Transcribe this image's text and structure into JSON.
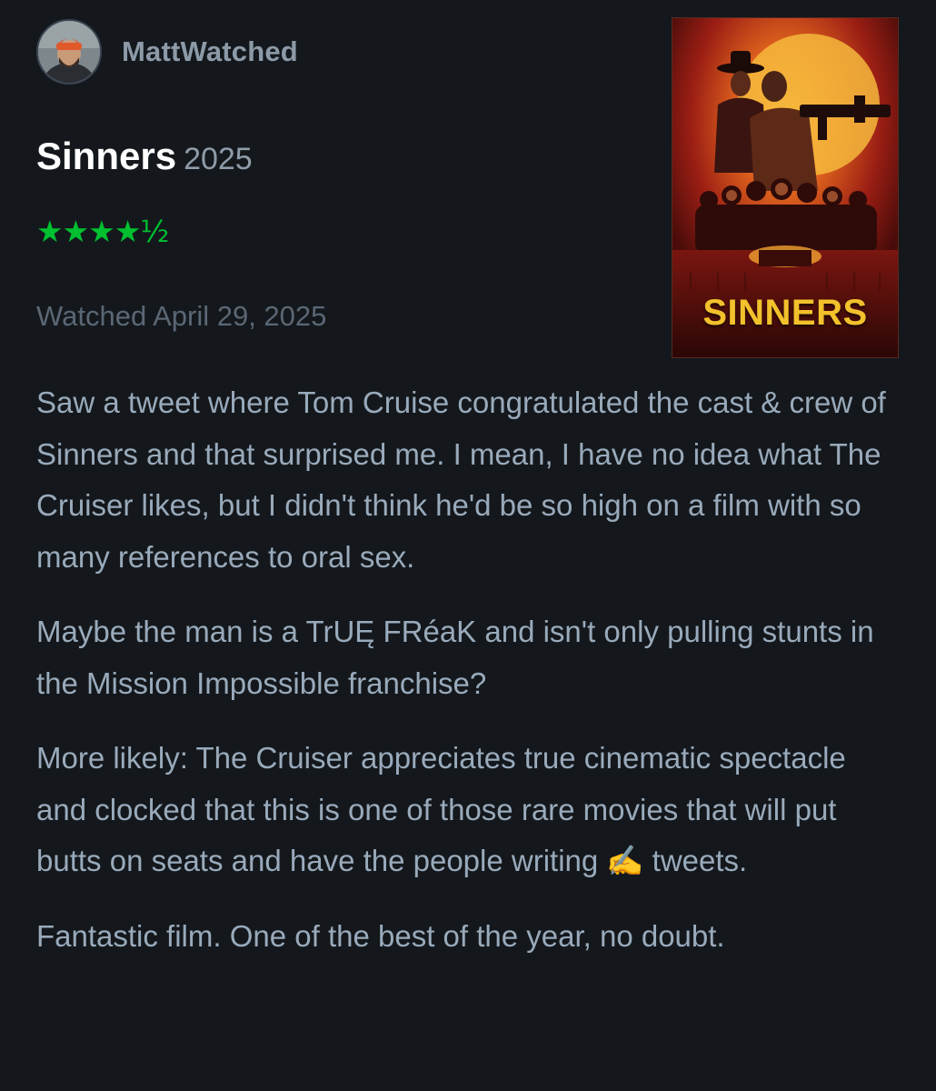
{
  "author": {
    "username": "MattWatched",
    "avatar_icon": "avatar-photo"
  },
  "film": {
    "title": "Sinners",
    "year": "2025",
    "rating_stars": "★★★★½",
    "rating": 4.5,
    "watched_label": "Watched April 29, 2025",
    "poster": {
      "title_text": "SINNERS",
      "accent": "#f2c12c"
    }
  },
  "review": {
    "paragraphs": [
      "Saw a tweet where Tom Cruise congratulated the cast & crew of Sinners and that surprised me. I mean, I have no idea what The Cruiser likes, but I didn't think he'd be so high on a film with so many references to oral sex.",
      "Maybe the man is a TrUĘ FRéaK and isn't only pulling stunts in the Mission Impossible franchise?",
      "More likely: The Cruiser appreciates true cinematic spectacle and clocked that this is one of those rare movies that will put butts on seats and have the people writing ✍️ tweets.",
      "Fantastic film. One of the best of the year, no doubt."
    ]
  },
  "colors": {
    "background": "#14181c",
    "rating_green": "#00c030",
    "text": "#99aabb",
    "muted": "#5b6775"
  }
}
